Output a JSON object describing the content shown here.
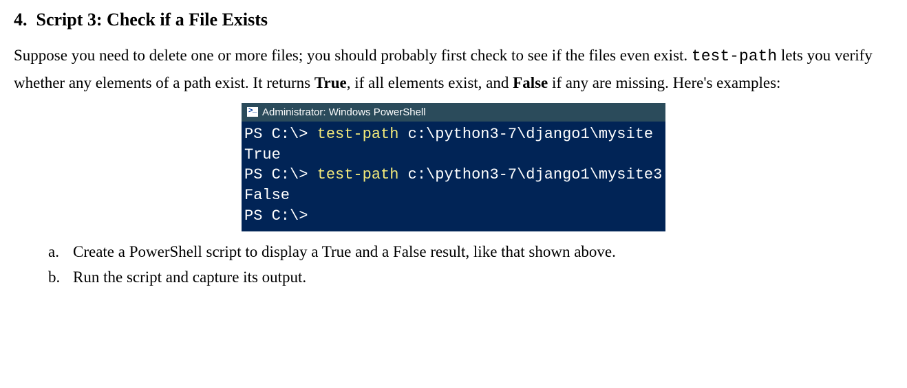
{
  "heading": {
    "number": "4.",
    "title": "Script 3: Check if a File Exists"
  },
  "paragraph": {
    "p1": "Suppose you need to delete one or more files; you should probably first check to see if the files even exist. ",
    "cmd": "test-path",
    "p2": " lets you verify whether any elements of a path exist. It returns ",
    "true": "True",
    "p3": ", if all elements exist, and ",
    "false": "False",
    "p4": " if any are missing. Here's examples:"
  },
  "console": {
    "title": "Administrator: Windows PowerShell",
    "lines": {
      "l1_prompt": "PS C:\\> ",
      "l1_cmd": "test-path",
      "l1_arg": " c:\\python3-7\\django1\\mysite",
      "l2_out": "True",
      "l3_prompt": "PS C:\\> ",
      "l3_cmd": "test-path",
      "l3_arg": " c:\\python3-7\\django1\\mysite3",
      "l4_out": "False",
      "l5_prompt": "PS C:\\>"
    }
  },
  "list": {
    "a_marker": "a.",
    "a_text": "Create a PowerShell script to display a True and a False result, like that shown above.",
    "b_marker": "b.",
    "b_text": "Run the script and capture its output."
  }
}
